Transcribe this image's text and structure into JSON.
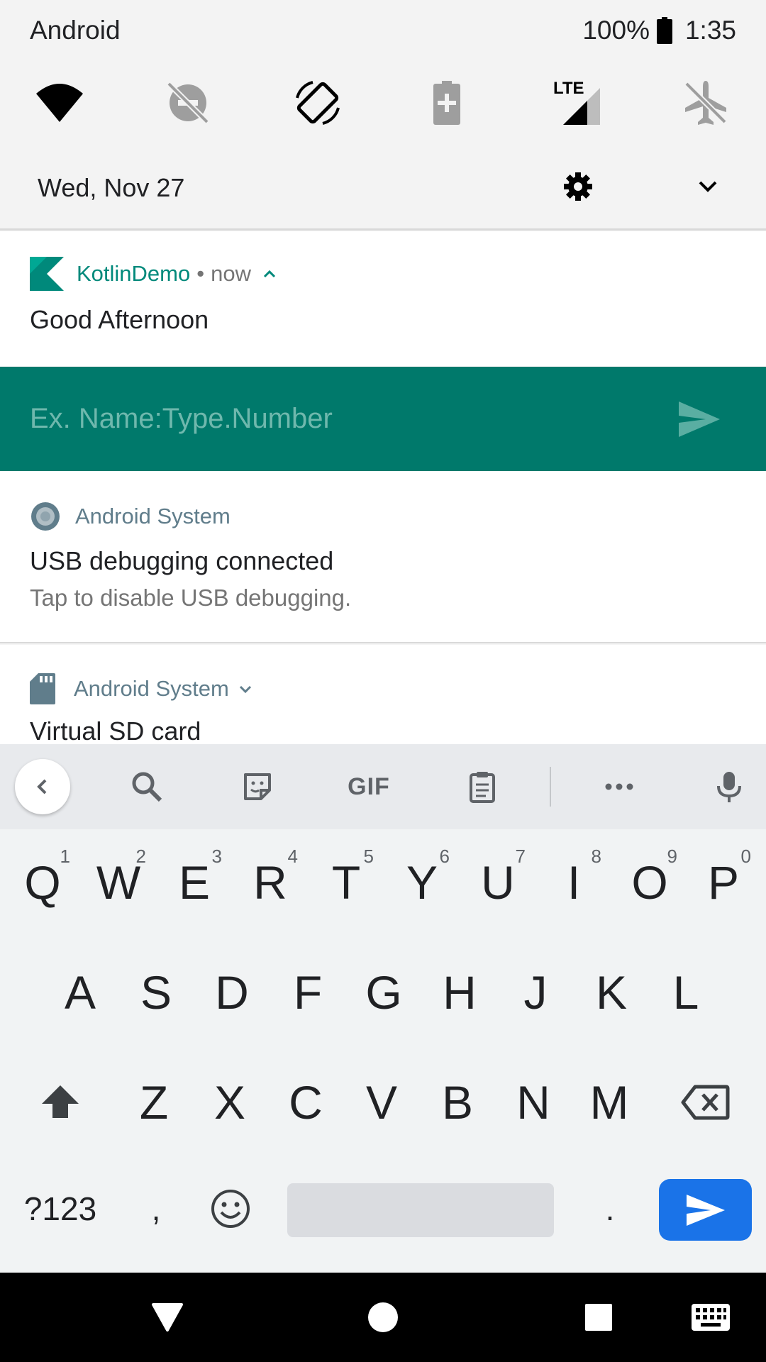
{
  "status_bar": {
    "carrier": "Android",
    "battery_percent": "100%",
    "time": "1:35"
  },
  "quick_settings": {
    "tiles": [
      {
        "name": "wifi-icon",
        "state": "on"
      },
      {
        "name": "do-not-disturb-icon",
        "state": "off"
      },
      {
        "name": "auto-rotate-icon",
        "state": "on"
      },
      {
        "name": "battery-saver-icon",
        "state": "off"
      },
      {
        "name": "mobile-data-icon",
        "state": "on",
        "label": "LTE"
      },
      {
        "name": "airplane-mode-icon",
        "state": "off"
      }
    ],
    "date": "Wed, Nov 27"
  },
  "notifications": {
    "kotlin": {
      "app_name": "KotlinDemo",
      "separator": "•",
      "time": "now",
      "title": "Good Afternoon",
      "reply_placeholder": "Ex. Name:Type.Number"
    },
    "usb": {
      "app_name": "Android System",
      "title": "USB debugging connected",
      "text": "Tap to disable USB debugging."
    },
    "sd_card": {
      "app_name": "Android System",
      "title": "Virtual SD card"
    }
  },
  "keyboard": {
    "toolbar": {
      "gif_label": "GIF"
    },
    "rows": [
      [
        {
          "label": "Q",
          "hint": "1"
        },
        {
          "label": "W",
          "hint": "2"
        },
        {
          "label": "E",
          "hint": "3"
        },
        {
          "label": "R",
          "hint": "4"
        },
        {
          "label": "T",
          "hint": "5"
        },
        {
          "label": "Y",
          "hint": "6"
        },
        {
          "label": "U",
          "hint": "7"
        },
        {
          "label": "I",
          "hint": "8"
        },
        {
          "label": "O",
          "hint": "9"
        },
        {
          "label": "P",
          "hint": "0"
        }
      ],
      [
        {
          "label": "A"
        },
        {
          "label": "S"
        },
        {
          "label": "D"
        },
        {
          "label": "F"
        },
        {
          "label": "G"
        },
        {
          "label": "H"
        },
        {
          "label": "J"
        },
        {
          "label": "K"
        },
        {
          "label": "L"
        }
      ],
      [
        {
          "label": "Z"
        },
        {
          "label": "X"
        },
        {
          "label": "C"
        },
        {
          "label": "V"
        },
        {
          "label": "B"
        },
        {
          "label": "N"
        },
        {
          "label": "M"
        }
      ]
    ],
    "symbols_label": "?123",
    "comma_label": ",",
    "period_label": "."
  },
  "colors": {
    "accent": "#00796b",
    "kotlin_app_name": "#00897b",
    "system_app_name": "#607d8b",
    "enter_key": "#1a73e8"
  }
}
